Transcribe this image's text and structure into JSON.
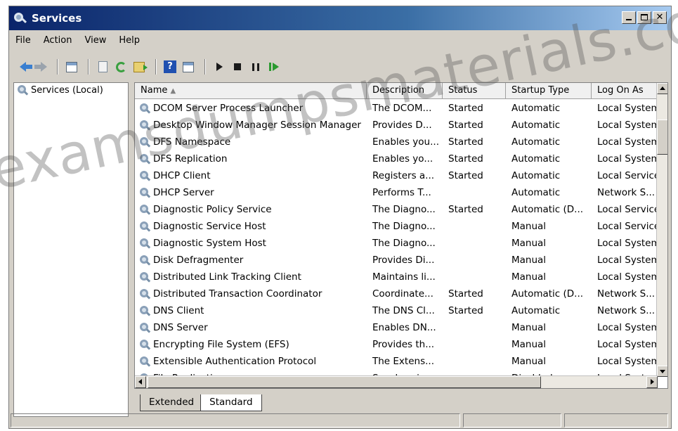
{
  "window": {
    "title": "Services"
  },
  "menu": [
    "File",
    "Action",
    "View",
    "Help"
  ],
  "toolbar": {
    "icons": [
      "back-icon",
      "forward-icon",
      "show-hide-tree-icon",
      "properties-icon",
      "refresh-icon",
      "export-list-icon",
      "help-icon",
      "show-hide-action-pane-icon",
      "start-service-icon",
      "stop-service-icon",
      "pause-service-icon",
      "resume-service-icon"
    ],
    "help_glyph": "?"
  },
  "tree": {
    "root_label": "Services (Local)"
  },
  "columns": [
    "Name",
    "Description",
    "Status",
    "Startup Type",
    "Log On As"
  ],
  "services": [
    [
      "DCOM Server Process Launcher",
      "The DCOM...",
      "Started",
      "Automatic",
      "Local System"
    ],
    [
      "Desktop Window Manager Session Manager",
      "Provides D...",
      "Started",
      "Automatic",
      "Local System"
    ],
    [
      "DFS Namespace",
      "Enables you...",
      "Started",
      "Automatic",
      "Local System"
    ],
    [
      "DFS Replication",
      "Enables yo...",
      "Started",
      "Automatic",
      "Local System"
    ],
    [
      "DHCP Client",
      "Registers a...",
      "Started",
      "Automatic",
      "Local Service"
    ],
    [
      "DHCP Server",
      "Performs T...",
      "",
      "Automatic",
      "Network S..."
    ],
    [
      "Diagnostic Policy Service",
      "The Diagno...",
      "Started",
      "Automatic (D...",
      "Local Service"
    ],
    [
      "Diagnostic Service Host",
      "The Diagno...",
      "",
      "Manual",
      "Local Service"
    ],
    [
      "Diagnostic System Host",
      "The Diagno...",
      "",
      "Manual",
      "Local System"
    ],
    [
      "Disk Defragmenter",
      "Provides Di...",
      "",
      "Manual",
      "Local System"
    ],
    [
      "Distributed Link Tracking Client",
      "Maintains li...",
      "",
      "Manual",
      "Local System"
    ],
    [
      "Distributed Transaction Coordinator",
      "Coordinate...",
      "Started",
      "Automatic (D...",
      "Network S..."
    ],
    [
      "DNS Client",
      "The DNS Cl...",
      "Started",
      "Automatic",
      "Network S..."
    ],
    [
      "DNS Server",
      "Enables DN...",
      "",
      "Manual",
      "Local System"
    ],
    [
      "Encrypting File System (EFS)",
      "Provides th...",
      "",
      "Manual",
      "Local System"
    ],
    [
      "Extensible Authentication Protocol",
      "The Extens...",
      "",
      "Manual",
      "Local System"
    ],
    [
      "File Replication",
      "Synchroniz...",
      "",
      "Disabled",
      "Local System"
    ]
  ],
  "tabs": [
    "Extended",
    "Standard"
  ],
  "watermark": "examsdumpsmaterials.com"
}
